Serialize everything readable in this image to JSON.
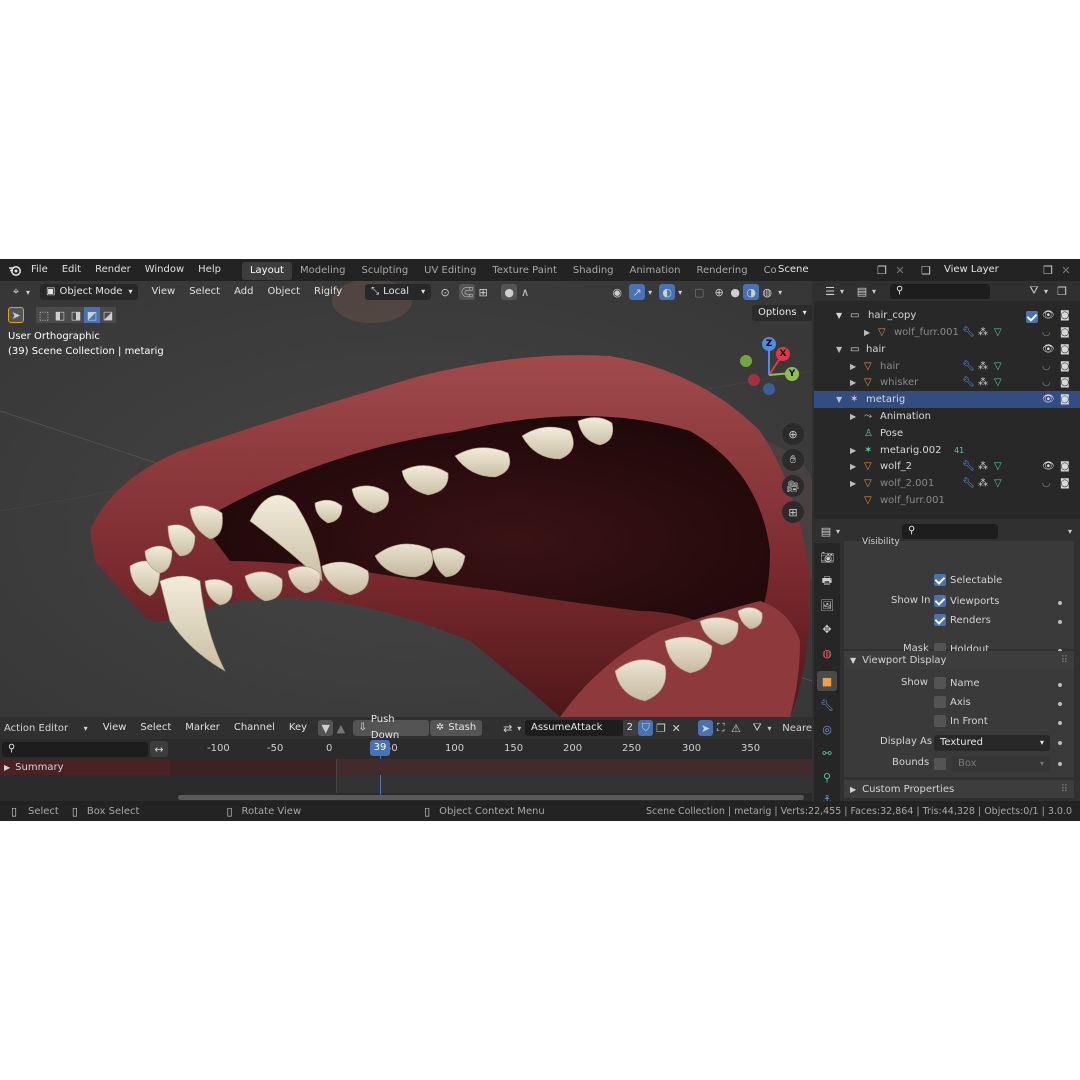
{
  "menu": [
    "File",
    "Edit",
    "Render",
    "Window",
    "Help"
  ],
  "workspaces": [
    {
      "label": "Layout",
      "active": true
    },
    {
      "label": "Modeling",
      "active": false
    },
    {
      "label": "Sculpting",
      "active": false
    },
    {
      "label": "UV Editing",
      "active": false
    },
    {
      "label": "Texture Paint",
      "active": false
    },
    {
      "label": "Shading",
      "active": false
    },
    {
      "label": "Animation",
      "active": false
    },
    {
      "label": "Rendering",
      "active": false
    },
    {
      "label": "Compo",
      "active": false
    }
  ],
  "scene": {
    "name": "Scene"
  },
  "view_layer": {
    "name": "View Layer"
  },
  "viewport": {
    "mode": "Object Mode",
    "menus": [
      "View",
      "Select",
      "Add",
      "Object",
      "Rigify"
    ],
    "transform_orientation": "Local",
    "options_label": "Options",
    "view_name": "User Orthographic",
    "collection_info": "(39) Scene Collection | metarig",
    "gizmo_axes": {
      "x": "X",
      "y": "Y",
      "z": "Z"
    }
  },
  "action_editor": {
    "editor_type": "Action Editor",
    "menus": [
      "View",
      "Select",
      "Marker",
      "Channel",
      "Key"
    ],
    "push_down": "Push Down",
    "stash": "Stash",
    "action_name": "AssumeAttack",
    "users": "2",
    "interpolation_partial": "Neare",
    "ruler": [
      "-100",
      "-50",
      "0",
      "39",
      "50",
      "100",
      "150",
      "200",
      "250",
      "300",
      "350"
    ],
    "current_frame": 39,
    "channel": "Summary"
  },
  "outliner": {
    "rows": [
      {
        "name": "wolf_furr.001",
        "indent": 3,
        "type": "mesh",
        "dim": true,
        "expand": "right"
      },
      {
        "name": "hair",
        "indent": 1,
        "type": "collection",
        "dim": false,
        "expand": "down"
      },
      {
        "name": "hair",
        "indent": 2,
        "type": "mesh",
        "dim": true,
        "expand": "right"
      },
      {
        "name": "whisker",
        "indent": 2,
        "type": "mesh",
        "dim": true,
        "expand": "right"
      },
      {
        "name": "metarig",
        "indent": 1,
        "type": "armature",
        "dim": false,
        "expand": "down",
        "selected": true
      },
      {
        "name": "Animation",
        "indent": 2,
        "type": "anim",
        "dim": false,
        "expand": "right"
      },
      {
        "name": "Pose",
        "indent": 2,
        "type": "pose",
        "dim": false,
        "expand": ""
      },
      {
        "name": "metarig.002",
        "indent": 2,
        "type": "armature-data",
        "dim": false,
        "expand": "right",
        "badge": "41"
      },
      {
        "name": "wolf_2",
        "indent": 2,
        "type": "mesh",
        "dim": false,
        "expand": "right"
      },
      {
        "name": "wolf_2.001",
        "indent": 2,
        "type": "mesh",
        "dim": true,
        "expand": "right"
      },
      {
        "name": "wolf_furr.001",
        "indent": 2,
        "type": "mesh",
        "dim": true,
        "expand": ""
      }
    ],
    "hair_copy_row": {
      "name": "hair_copy"
    }
  },
  "properties": {
    "visibility_header": "Visibility",
    "selectable": "Selectable",
    "show_in_label": "Show In",
    "viewports": "Viewports",
    "renders": "Renders",
    "mask_label": "Mask",
    "holdout": "Holdout",
    "viewport_display": "Viewport Display",
    "show_label": "Show",
    "name_opt": "Name",
    "axis_opt": "Axis",
    "in_front_opt": "In Front",
    "display_as_label": "Display As",
    "display_as_value": "Textured",
    "bounds_label": "Bounds",
    "bounds_value": "Box",
    "custom_properties": "Custom Properties"
  },
  "status": {
    "select": "Select",
    "box_select": "Box Select",
    "rotate_view": "Rotate View",
    "context_menu": "Object Context Menu",
    "stats": "Scene Collection | metarig | Verts:22,455 | Faces:32,864 | Tris:44,328 | Objects:0/1 | 3.0.0"
  },
  "colors": {
    "accent": "#4772b3",
    "selection": "#334d80",
    "gum": "#7a2a2e",
    "tooth": "#e8e0cc"
  }
}
